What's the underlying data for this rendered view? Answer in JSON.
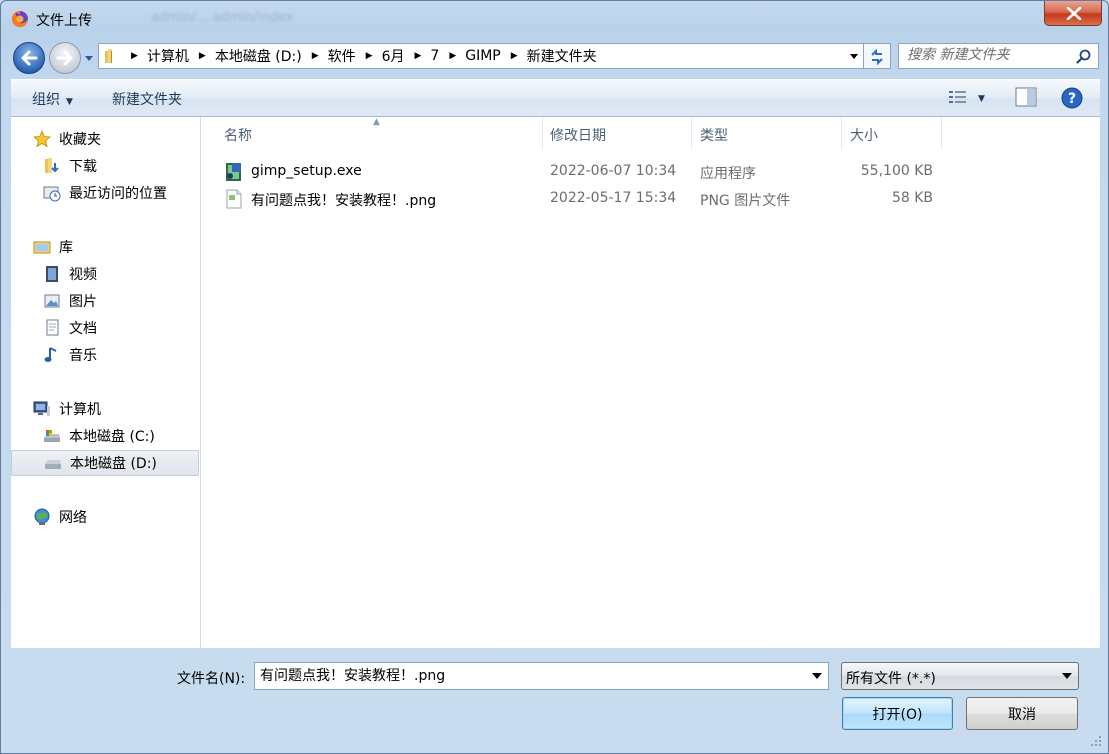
{
  "window": {
    "title": "文件上传",
    "background_url": "admin/... admin/index"
  },
  "navigation": {
    "breadcrumbs": [
      "计算机",
      "本地磁盘 (D:)",
      "软件",
      "6月",
      "7",
      "GIMP",
      "新建文件夹"
    ],
    "search_placeholder": "搜索 新建文件夹"
  },
  "toolbar": {
    "organize_label": "组织",
    "new_folder_label": "新建文件夹"
  },
  "sidebar": {
    "favorites": {
      "label": "收藏夹",
      "icon": "star-icon"
    },
    "favorites_items": [
      {
        "label": "下载",
        "icon": "download-folder-icon"
      },
      {
        "label": "最近访问的位置",
        "icon": "recent-places-icon"
      }
    ],
    "libraries": {
      "label": "库",
      "icon": "library-icon"
    },
    "libraries_items": [
      {
        "label": "视频",
        "icon": "video-icon"
      },
      {
        "label": "图片",
        "icon": "pictures-icon"
      },
      {
        "label": "文档",
        "icon": "documents-icon"
      },
      {
        "label": "音乐",
        "icon": "music-icon"
      }
    ],
    "computer": {
      "label": "计算机",
      "icon": "computer-icon"
    },
    "computer_items": [
      {
        "label": "本地磁盘 (C:)",
        "icon": "system-drive-icon"
      },
      {
        "label": "本地磁盘 (D:)",
        "icon": "drive-icon",
        "selected": true
      }
    ],
    "network": {
      "label": "网络",
      "icon": "network-icon"
    }
  },
  "filelist": {
    "columns": [
      "名称",
      "修改日期",
      "类型",
      "大小"
    ],
    "rows": [
      {
        "name": "gimp_setup.exe",
        "modified": "2022-06-07 10:34",
        "type": "应用程序",
        "size": "55,100 KB",
        "icon": "exe-file-icon"
      },
      {
        "name": "有问题点我！安装教程！.png",
        "modified": "2022-05-17 15:34",
        "type": "PNG 图片文件",
        "size": "58 KB",
        "icon": "png-file-icon"
      }
    ]
  },
  "bottom": {
    "filename_label": "文件名(N):",
    "filename_value": "有问题点我！安装教程！.png",
    "filter_value": "所有文件 (*.*)",
    "open_label": "打开(O)",
    "cancel_label": "取消"
  },
  "colors": {
    "window_frame": "#c9dcef",
    "close_button": "#c6391b",
    "selection": "#dfe5ec",
    "column_header_text": "#4c607a"
  }
}
